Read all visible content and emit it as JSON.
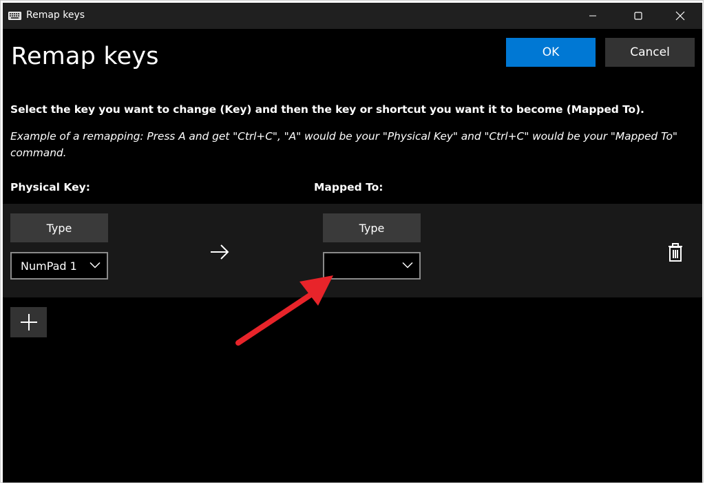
{
  "window": {
    "title": "Remap keys"
  },
  "header": {
    "page_title": "Remap keys",
    "ok_label": "OK",
    "cancel_label": "Cancel"
  },
  "instructions": {
    "main": "Select the key you want to change (Key) and then the key or shortcut you want it to become (Mapped To).",
    "example": "Example of a remapping: Press A and get \"Ctrl+C\", \"A\" would be your \"Physical Key\" and \"Ctrl+C\" would be your \"Mapped To\" command."
  },
  "columns": {
    "physical_label": "Physical Key:",
    "mapped_label": "Mapped To:"
  },
  "mapping": {
    "physical_type_label": "Type",
    "physical_value": "NumPad 1",
    "mapped_type_label": "Type",
    "mapped_value": ""
  },
  "icons": {
    "app": "keyboard-icon",
    "arrow": "arrow-right-icon",
    "delete": "trash-icon",
    "add": "plus-icon",
    "annotation": "red-annotation-arrow"
  },
  "colors": {
    "accent": "#0078d4",
    "annotation": "#e8242a"
  }
}
